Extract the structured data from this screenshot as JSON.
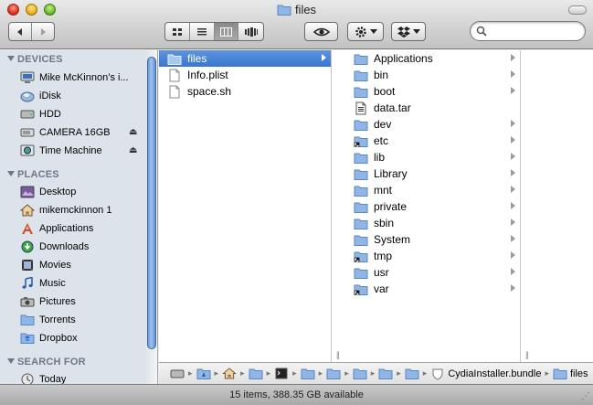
{
  "window": {
    "title": "files"
  },
  "toolbar": {
    "nav_back": "back",
    "nav_forward": "forward",
    "view_modes": [
      "icon-view",
      "list-view",
      "column-view",
      "coverflow-view"
    ],
    "active_view": "column-view",
    "quicklook": "eye-icon",
    "action": "gear-icon",
    "dropbox": "dropbox-icon",
    "search": {
      "value": "",
      "placeholder": ""
    }
  },
  "sidebar": {
    "devices_header": "DEVICES",
    "devices": [
      {
        "label": "Mike McKinnon’s i...",
        "icon": "computer-icon",
        "eject": false
      },
      {
        "label": "iDisk",
        "icon": "idisk-icon",
        "eject": false
      },
      {
        "label": "HDD",
        "icon": "hard-drive-icon",
        "eject": false
      },
      {
        "label": "CAMERA 16GB",
        "icon": "disk-icon",
        "eject": true
      },
      {
        "label": "Time Machine",
        "icon": "time-machine-icon",
        "eject": true
      }
    ],
    "places_header": "PLACES",
    "places": [
      {
        "label": "Desktop",
        "icon": "desktop-icon"
      },
      {
        "label": "mikemckinnon 1",
        "icon": "home-icon"
      },
      {
        "label": "Applications",
        "icon": "applications-icon"
      },
      {
        "label": "Downloads",
        "icon": "downloads-icon"
      },
      {
        "label": "Movies",
        "icon": "movies-icon"
      },
      {
        "label": "Music",
        "icon": "music-icon"
      },
      {
        "label": "Pictures",
        "icon": "pictures-icon"
      },
      {
        "label": "Torrents",
        "icon": "folder-icon"
      },
      {
        "label": "Dropbox",
        "icon": "dropbox-icon"
      }
    ],
    "search_header": "SEARCH FOR",
    "search_for": [
      {
        "label": "Today",
        "icon": "clock-icon"
      }
    ]
  },
  "columns": {
    "first": [
      {
        "name": "files",
        "type": "folder",
        "selected": true,
        "has_children": true
      },
      {
        "name": "Info.plist",
        "type": "file",
        "selected": false,
        "has_children": false
      },
      {
        "name": "space.sh",
        "type": "file",
        "selected": false,
        "has_children": false
      }
    ],
    "second": [
      {
        "name": "Applications",
        "type": "folder",
        "alias": false
      },
      {
        "name": "bin",
        "type": "folder",
        "alias": false
      },
      {
        "name": "boot",
        "type": "folder",
        "alias": false
      },
      {
        "name": "data.tar",
        "type": "file",
        "alias": false
      },
      {
        "name": "dev",
        "type": "folder",
        "alias": false
      },
      {
        "name": "etc",
        "type": "folder",
        "alias": true
      },
      {
        "name": "lib",
        "type": "folder",
        "alias": false
      },
      {
        "name": "Library",
        "type": "folder",
        "alias": false
      },
      {
        "name": "mnt",
        "type": "folder",
        "alias": false
      },
      {
        "name": "private",
        "type": "folder",
        "alias": false
      },
      {
        "name": "sbin",
        "type": "folder",
        "alias": false
      },
      {
        "name": "System",
        "type": "folder",
        "alias": false
      },
      {
        "name": "tmp",
        "type": "folder",
        "alias": true
      },
      {
        "name": "usr",
        "type": "folder",
        "alias": false
      },
      {
        "name": "var",
        "type": "folder",
        "alias": true
      }
    ]
  },
  "pathbar": {
    "items": [
      {
        "label": "",
        "icon": "hard-drive-icon"
      },
      {
        "label": "",
        "icon": "applications-folder-icon"
      },
      {
        "label": "",
        "icon": "home-icon"
      },
      {
        "label": "",
        "icon": "folder-icon"
      },
      {
        "label": "",
        "icon": "terminal-icon"
      },
      {
        "label": "",
        "icon": "folder-icon"
      },
      {
        "label": "",
        "icon": "folder-icon"
      },
      {
        "label": "",
        "icon": "folder-icon"
      },
      {
        "label": "",
        "icon": "folder-icon"
      },
      {
        "label": "",
        "icon": "folder-icon"
      },
      {
        "label": "CydiaInstaller.bundle",
        "icon": "bundle-icon"
      },
      {
        "label": "files",
        "icon": "folder-icon"
      }
    ]
  },
  "status": {
    "text": "15 items, 388.35 GB available"
  },
  "colors": {
    "selection": "#3a76cf",
    "sidebar_bg": "#dde3ea",
    "folder": "#8fb6e6"
  }
}
